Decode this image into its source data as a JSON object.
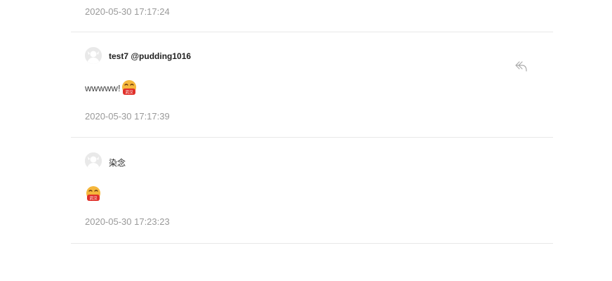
{
  "comments": [
    {
      "timestamp": "2020-05-30 17:17:24"
    },
    {
      "author": "test7 @pudding1016",
      "text": "wwwww!",
      "emoji": "wuhan-face-emoji",
      "emoji_badge": "武汉",
      "timestamp": "2020-05-30 17:17:39",
      "reply_icon": "reply-arrow-icon"
    },
    {
      "author": "染念",
      "text": "",
      "emoji": "wuhan-face-emoji",
      "emoji_badge": "武汉",
      "timestamp": "2020-05-30 17:23:23"
    }
  ],
  "colors": {
    "divider": "#e8e8e8",
    "timestamp": "#999999",
    "author": "#222222",
    "emoji_face": "#f5b73b",
    "emoji_mask": "#e0302a"
  }
}
